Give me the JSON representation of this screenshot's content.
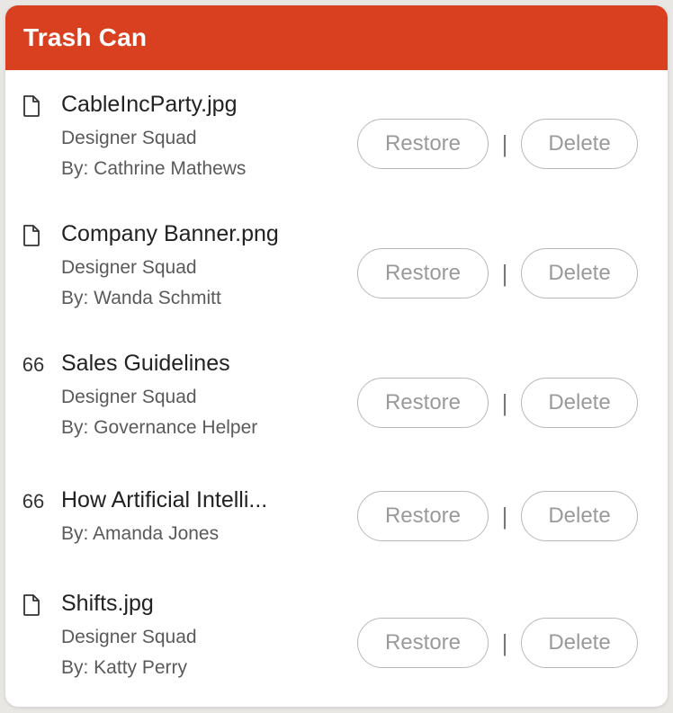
{
  "header": {
    "title": "Trash Can"
  },
  "actions": {
    "restore_label": "Restore",
    "delete_label": "Delete",
    "separator": "|"
  },
  "items": [
    {
      "icon": "file-icon",
      "title": "CableIncParty.jpg",
      "group": "Designer Squad",
      "author": "By: Cathrine Mathews"
    },
    {
      "icon": "file-icon",
      "title": "Company Banner.png",
      "group": "Designer Squad",
      "author": "By: Wanda Schmitt"
    },
    {
      "icon": "quote-icon",
      "icon_text": "66",
      "title": "Sales Guidelines",
      "group": "Designer Squad",
      "author": "By: Governance Helper"
    },
    {
      "icon": "quote-icon",
      "icon_text": "66",
      "title": "How Artificial Intelli...",
      "author": "By: Amanda Jones"
    },
    {
      "icon": "file-icon",
      "title": "Shifts.jpg",
      "group": "Designer Squad",
      "author": "By: Katty Perry"
    }
  ]
}
